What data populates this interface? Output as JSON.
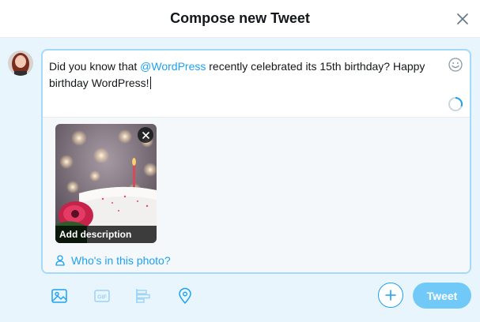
{
  "header": {
    "title": "Compose new Tweet",
    "close_icon": "close-icon"
  },
  "composer": {
    "text_before": "Did you know that ",
    "mention": "@WordPress",
    "text_after": " recently celebrated its 15th birthday? Happy birthday WordPress!",
    "emoji_icon": "smiley-icon",
    "counter_icon": "char-counter-ring"
  },
  "media": {
    "add_description": "Add description",
    "tag_people": "Who's in this photo?",
    "remove_icon": "close-icon",
    "tag_icon": "person-icon"
  },
  "toolbar": {
    "icons": [
      "image-icon",
      "gif-icon",
      "poll-icon",
      "location-icon"
    ],
    "add_icon": "plus-icon",
    "tweet_label": "Tweet"
  },
  "colors": {
    "accent": "#1da1f2",
    "tweet_button_disabled": "#71c9f8",
    "backdrop": "#e8f5fd",
    "composer_border": "#a4d9f9"
  }
}
